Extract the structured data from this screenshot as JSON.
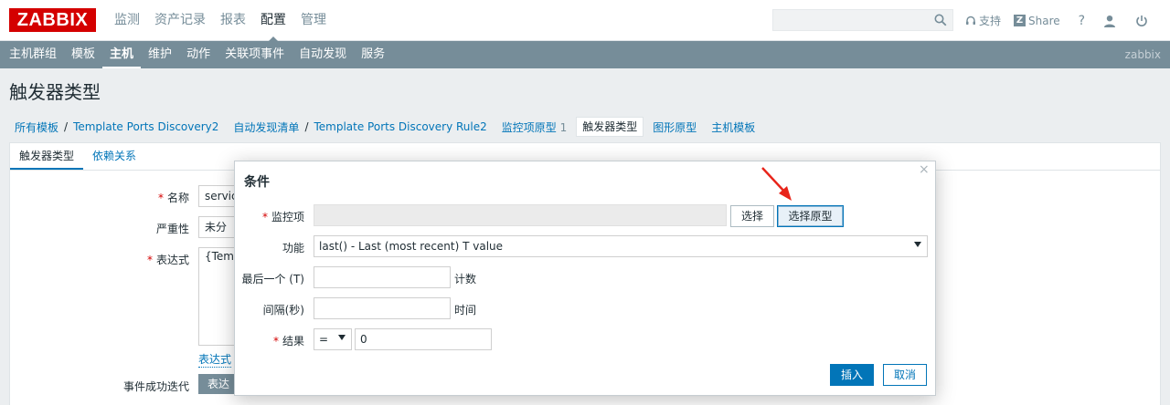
{
  "topbar": {
    "logo": "ZABBIX",
    "menu": [
      {
        "label": "监测",
        "active": false
      },
      {
        "label": "资产记录",
        "active": false
      },
      {
        "label": "报表",
        "active": false
      },
      {
        "label": "配置",
        "active": true
      },
      {
        "label": "管理",
        "active": false
      }
    ],
    "search_value": "",
    "support_label": "支持",
    "share_label": "Share",
    "help_label": "?",
    "share_badge": "Z"
  },
  "submenu": {
    "items": [
      {
        "label": "主机群组",
        "active": false
      },
      {
        "label": "模板",
        "active": false
      },
      {
        "label": "主机",
        "active": true
      },
      {
        "label": "维护",
        "active": false
      },
      {
        "label": "动作",
        "active": false
      },
      {
        "label": "关联项事件",
        "active": false
      },
      {
        "label": "自动发现",
        "active": false
      },
      {
        "label": "服务",
        "active": false
      }
    ],
    "server_name": "zabbix"
  },
  "page": {
    "title": "触发器类型"
  },
  "breadcrumbs": {
    "all_templates": "所有模板",
    "sep": "/",
    "template": "Template Ports Discovery2",
    "discovery_list": "自动发现清单",
    "rule": "Template Ports Discovery Rule2",
    "item_prototypes": "监控项原型",
    "item_prototypes_count": "1",
    "trigger_prototypes": "触发器类型",
    "graph_prototypes": "图形原型",
    "host_templates": "主机模板"
  },
  "form": {
    "tabs": [
      "触发器类型",
      "依赖关系"
    ],
    "name_label": "名称",
    "name_value": "servic",
    "severity_label": "严重性",
    "severity_value": "未分",
    "expression_label": "表达式",
    "expression_value": "{Temp",
    "expression_link": "表达式",
    "ok_event_label": "事件成功迭代",
    "ok_event_button": "表达"
  },
  "modal": {
    "title": "条件",
    "close": "×",
    "item_label": "监控项",
    "item_value": "",
    "select_button": "选择",
    "select_prototype_button": "选择原型",
    "function_label": "功能",
    "function_value": "last() - Last (most recent) T value",
    "last_label": "最后一个 (T)",
    "last_value": "",
    "last_hint": "计数",
    "interval_label": "间隔(秒)",
    "interval_value": "",
    "interval_hint": "时间",
    "result_label": "结果",
    "result_operator": "=",
    "result_value": "0",
    "insert_button": "插入",
    "cancel_button": "取消"
  },
  "colors": {
    "brand": "#d40000",
    "accent": "#0275b8",
    "subbar": "#768d99",
    "annotation": "#e8241a"
  }
}
